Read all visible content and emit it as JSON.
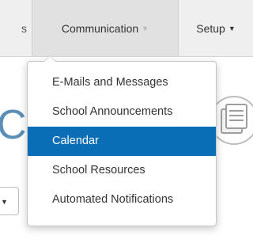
{
  "navbar": {
    "left_fragment": "s",
    "communication_label": "Communication",
    "setup_label": "Setup",
    "caret_icon": "caret-down-icon"
  },
  "page": {
    "heading_fragment": "Cal"
  },
  "dropdown": {
    "items": [
      {
        "label": "E-Mails and Messages",
        "active": false
      },
      {
        "label": "School Announcements",
        "active": false
      },
      {
        "label": "Calendar",
        "active": true
      },
      {
        "label": "School Resources",
        "active": false
      },
      {
        "label": "Automated Notifications",
        "active": false
      }
    ],
    "active_color": "#0a6eb6"
  }
}
